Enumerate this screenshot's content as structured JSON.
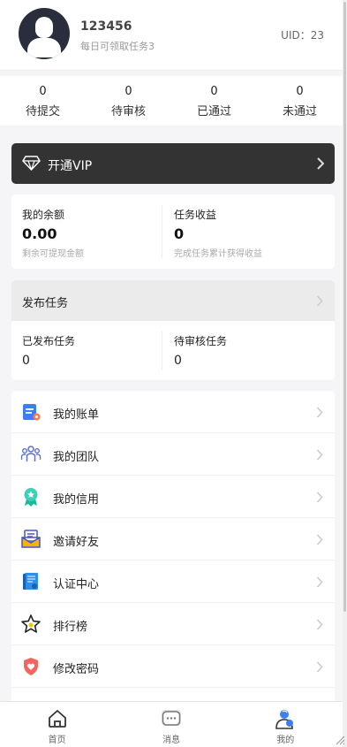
{
  "profile": {
    "username": "123456",
    "subtitle": "每日可领取任务3",
    "uid_label": "UID：23"
  },
  "stats": [
    {
      "count": "0",
      "label": "待提交"
    },
    {
      "count": "0",
      "label": "待审核"
    },
    {
      "count": "0",
      "label": "已通过"
    },
    {
      "count": "0",
      "label": "未通过"
    }
  ],
  "vip": {
    "label": "开通VIP"
  },
  "balance": {
    "title": "我的余额",
    "value": "0.00",
    "sub": "剩余可提现金额"
  },
  "earnings": {
    "title": "任务收益",
    "value": "0",
    "sub": "完成任务累计获得收益"
  },
  "publish": {
    "header": "发布任务",
    "published_label": "已发布任务",
    "published_count": "0",
    "pending_label": "待审核任务",
    "pending_count": "0"
  },
  "menu": [
    {
      "label": "我的账单",
      "icon": "bill-icon"
    },
    {
      "label": "我的团队",
      "icon": "team-icon"
    },
    {
      "label": "我的信用",
      "icon": "credit-badge-icon"
    },
    {
      "label": "邀请好友",
      "icon": "invite-envelope-icon"
    },
    {
      "label": "认证中心",
      "icon": "certificate-icon"
    },
    {
      "label": "排行榜",
      "icon": "star-icon"
    },
    {
      "label": "修改密码",
      "icon": "shield-heart-icon"
    }
  ],
  "tabbar": [
    {
      "label": "首页",
      "icon": "home-icon"
    },
    {
      "label": "消息",
      "icon": "message-icon"
    },
    {
      "label": "我的",
      "icon": "profile-icon",
      "active": true
    }
  ],
  "colors": {
    "vip_bar": "#333334",
    "accent_blue": "#3d7ef5",
    "page_bg": "#f5f5f7"
  }
}
